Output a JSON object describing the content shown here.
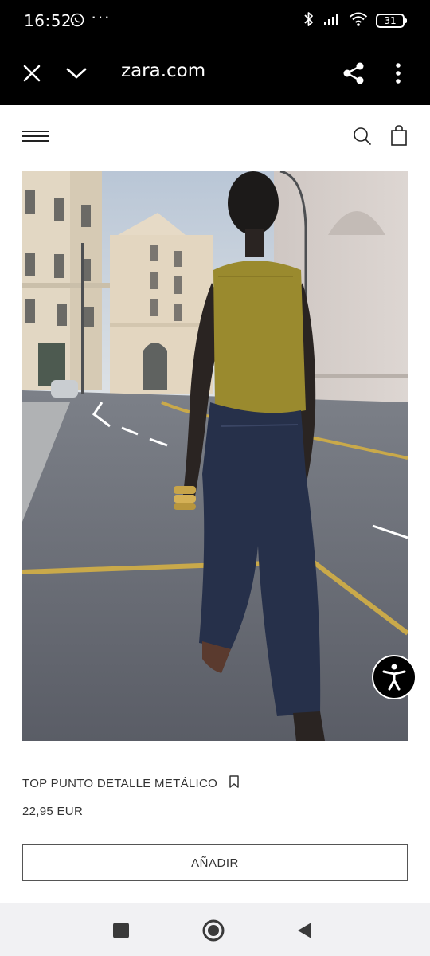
{
  "status_bar": {
    "time": "16:52",
    "more_indicator": "···",
    "battery_level": "31",
    "icons": [
      "whatsapp-icon",
      "bluetooth-icon",
      "signal-icon",
      "wifi-icon",
      "battery-icon"
    ]
  },
  "browser": {
    "url": "zara.com",
    "icons": [
      "close-icon",
      "chevron-down-icon",
      "share-icon",
      "more-vert-icon"
    ]
  },
  "header": {
    "icons": [
      "menu-icon",
      "search-icon",
      "shopping-bag-icon"
    ]
  },
  "product": {
    "name": "TOP PUNTO DETALLE METÁLICO",
    "price": "22,95 EUR",
    "add_label": "AÑADIR",
    "image": {
      "description_icon": "product-photo",
      "colors": {
        "top": "#9a8a2e",
        "jeans": "#26304a",
        "sky": "#c9d2dc",
        "road": "#6a6d74"
      }
    }
  },
  "accessibility": {
    "icon": "accessibility-icon"
  },
  "nav_bar": {
    "icons": [
      "recents-icon",
      "home-icon",
      "back-icon"
    ]
  }
}
